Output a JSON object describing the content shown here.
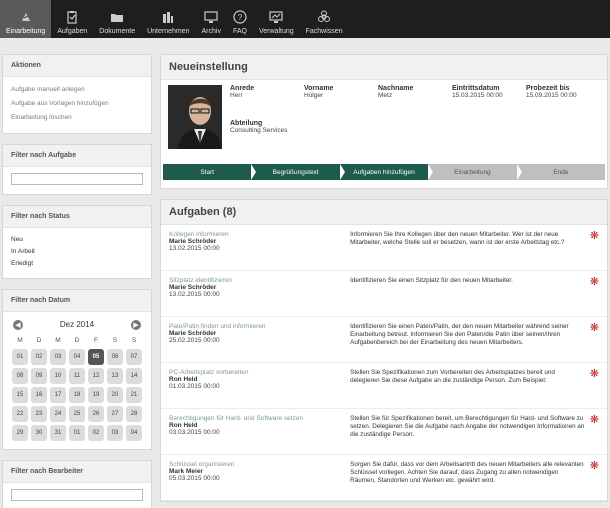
{
  "nav": [
    {
      "label": "Einarbeitung",
      "icon": "onboarding-icon",
      "active": true
    },
    {
      "label": "Aufgaben",
      "icon": "clipboard-icon"
    },
    {
      "label": "Dokumente",
      "icon": "folder-icon"
    },
    {
      "label": "Unternehmen",
      "icon": "building-icon"
    },
    {
      "label": "Archiv",
      "icon": "archive-icon"
    },
    {
      "label": "FAQ",
      "icon": "help-icon"
    },
    {
      "label": "Verwaltung",
      "icon": "monitor-icon"
    },
    {
      "label": "Fachwissen",
      "icon": "biohazard-icon"
    }
  ],
  "sidebar": {
    "actions_title": "Aktionen",
    "actions": [
      "Aufgabe manuell anlegen",
      "Aufgabe aus Vorlagen hinzufügen",
      "Einarbeitung löschen"
    ],
    "filter_task_title": "Filter nach Aufgabe",
    "filter_task_value": "",
    "filter_status_title": "Filter nach Status",
    "statuses": [
      "Neu",
      "In Arbeit",
      "Erledigt"
    ],
    "filter_date_title": "Filter nach Datum",
    "calendar": {
      "month": "Dez 2014",
      "prev": "◀",
      "next": "▶",
      "dow": [
        "M",
        "D",
        "M",
        "D",
        "F",
        "S",
        "S"
      ],
      "days": [
        "01",
        "02",
        "03",
        "04",
        "05",
        "06",
        "07",
        "08",
        "09",
        "10",
        "11",
        "12",
        "13",
        "14",
        "15",
        "16",
        "17",
        "18",
        "19",
        "20",
        "21",
        "22",
        "23",
        "24",
        "25",
        "26",
        "27",
        "28",
        "29",
        "30",
        "31",
        "01",
        "02",
        "03",
        "04"
      ],
      "selected": "05"
    },
    "filter_editor_title": "Filter nach Bearbeiter",
    "filter_editor_value": ""
  },
  "profile": {
    "title": "Neueinstellung",
    "labels": {
      "salutation": "Anrede",
      "firstname": "Vorname",
      "lastname": "Nachname",
      "start": "Eintrittsdatum",
      "probation": "Probezeit bis",
      "department": "Abteilung"
    },
    "values": {
      "salutation": "Herr",
      "firstname": "Holger",
      "lastname": "Metz",
      "start": "15.03.2015 00:00",
      "probation": "15.09.2015 00:00",
      "department": "Consulting Services"
    }
  },
  "steps": [
    {
      "label": "Start",
      "state": "done"
    },
    {
      "label": "Begrüßungstext",
      "state": "done"
    },
    {
      "label": "Aufgaben hinzufügen",
      "state": "done"
    },
    {
      "label": "Einarbeitung",
      "state": "todo"
    },
    {
      "label": "Ende",
      "state": "todo"
    }
  ],
  "tasks_title": "Aufgaben (8)",
  "tasks": [
    {
      "name": "Kollegen informieren",
      "person": "Marie Schröder",
      "date": "13.02.2015 00:00",
      "desc": "Informieren Sie Ihre Kollegen über den neuen Mitarbeiter. Wer ist der neue Mitarbeiter, welche Stelle soll er besetzen, wann ist der erste Arbeitstag etc.?"
    },
    {
      "name": "Sitzplatz identifizieren",
      "person": "Marie Schröder",
      "date": "13.02.2015 00:00",
      "desc": "Identifizieren Sie einen Sitzplatz für den neuen Mitarbeiter."
    },
    {
      "name": "Pate/Patin finden und informieren",
      "person": "Marie Schröder",
      "date": "25.02.2015 00:00",
      "desc": "Identifizieren Sie einen Paten/Patin, der den neuen Mitarbeiter während seiner Einarbeitung betreut. Informieren Sie den Paten/die Patin über seinen/ihren Aufgabenbereich bei der Einarbeitung des neuen Mitarbeiters."
    },
    {
      "name": "PC-Arbeitsplatz vorbereiten",
      "person": "Ron Held",
      "date": "01.03.2015 00:00",
      "desc": "Stellen Sie Spezifikationen zum Vorbereiten des Arbeitsplatzes bereit und delegieren Sie diese Aufgabe an die zuständige Person. Zum Beispiel:"
    },
    {
      "name": "Berechtigungen für Hard- und Software setzen",
      "person": "Ron Held",
      "date": "03.03.2015 00:00",
      "desc": "Stellen Sie für Spezifikationen bereit, um Berechtigungen für Hard- und Software zu setzen. Delegieren Sie die Aufgabe nach Angabe der notwendigen Informationen an die zuständige Person."
    },
    {
      "name": "Schlüssel organisieren",
      "person": "Mark Meier",
      "date": "05.03.2015 00:00",
      "desc": "Sorgen Sie dafür, dass vor dem Arbeitsantritt des neuen Mitarbeiters alle relevanten Schlüssel vorliegen. Achten Sie darauf, dass Zugang zu allen notwendigen Räumen, Standorten und Werken etc. gewährt wird."
    }
  ],
  "flag_glyph": "❋",
  "colors": {
    "nav_bg": "#1e1e1e",
    "nav_active": "#5a5a5a",
    "step_done": "#1f5b4c",
    "step_todo": "#bfbfbf",
    "flag": "#c91d1d",
    "task_link": "#7c9c8e"
  }
}
